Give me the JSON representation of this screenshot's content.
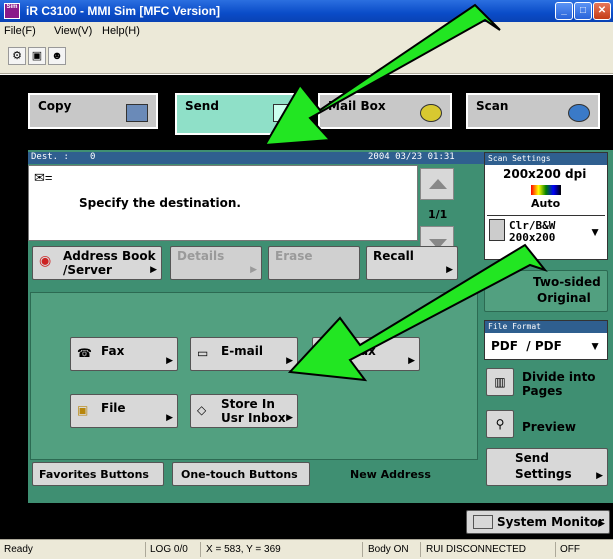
{
  "window": {
    "title": "iR C3100 - MMI Sim [MFC Version]",
    "icon_text": "Sim"
  },
  "menu": [
    "File(F)",
    "View(V)",
    "Help(H)"
  ],
  "tabs": {
    "copy": "Copy",
    "send": "Send",
    "mailbox": "Mail Box",
    "scan": "Scan"
  },
  "dest": {
    "label": "Dest. :",
    "count": "0",
    "datetime": "2004 03/23 01:31",
    "message": "Specify the destination.",
    "page": "1/1"
  },
  "actions": {
    "address_book_1": "Address Book",
    "address_book_2": "/Server",
    "details": "Details",
    "erase": "Erase",
    "recall": "Recall"
  },
  "send_types": {
    "fax": "Fax",
    "email": "E-mail",
    "ifax": "I-Fax",
    "file": "File",
    "store_1": "Store In",
    "store_2": "Usr Inbox"
  },
  "bottom_tabs": {
    "favorites": "Favorites Buttons",
    "onetouch": "One-touch Buttons",
    "new_address": "New Address"
  },
  "scan_settings": {
    "header": "Scan Settings",
    "dpi": "200x200 dpi",
    "mode": "Auto",
    "color_1": "Clr/B&W",
    "color_2": "200x200"
  },
  "two_sided": {
    "line1": "Two-sided",
    "line2": "Original"
  },
  "file_format": {
    "header": "File Format",
    "value": "PDF  / PDF"
  },
  "divide": {
    "line1": "Divide into",
    "line2": "Pages"
  },
  "preview": "Preview",
  "send_settings": {
    "line1": "Send",
    "line2": "Settings"
  },
  "system_monitor": "System Monitor",
  "status": {
    "ready": "Ready",
    "log": "LOG 0/0",
    "coords": "X = 583, Y = 369",
    "body": "Body ON",
    "rui": "RUI DISCONNECTED",
    "off": "OFF"
  },
  "colors": {
    "panel": "#3f8f72",
    "active_tab": "#8fe0c8",
    "arrow": "#1fe61f",
    "header": "#2f5f8f"
  }
}
